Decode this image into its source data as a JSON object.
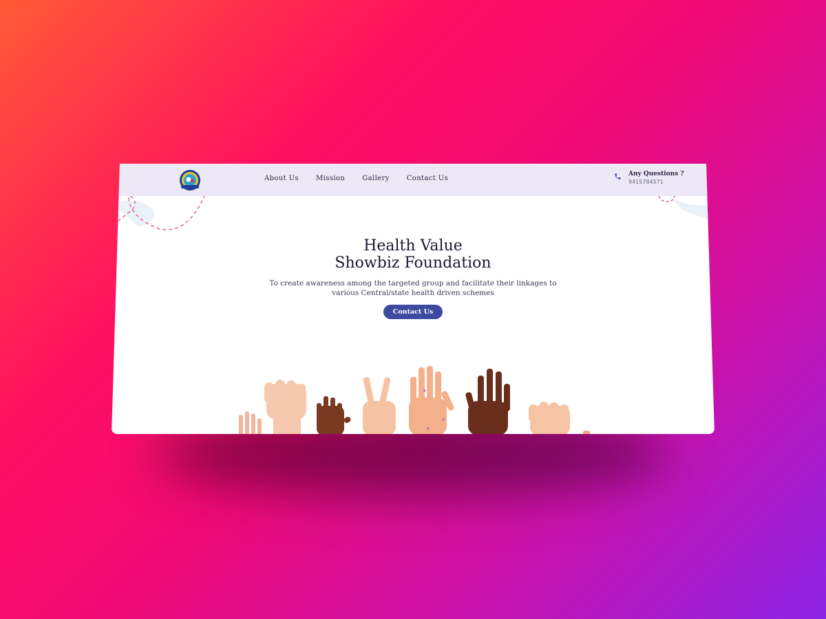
{
  "nav": {
    "logo_name": "foundation-logo",
    "links": [
      "About Us",
      "Mission",
      "Gallery",
      "Contact Us"
    ]
  },
  "contact": {
    "title": "Any Questions ?",
    "phone": "9415784571",
    "icon": "phone-icon"
  },
  "hero": {
    "title_line1": "Health Value",
    "title_line2": "Showbiz Foundation",
    "subtitle": "To create awareness among the targeted group and facilitate their linkages to various Central/state health driven schemes",
    "button_label": "Contact Us"
  },
  "colors": {
    "navbar_bg": "#ece8f6",
    "accent": "#3d4aa0",
    "deco_pink": "#e8638a"
  }
}
